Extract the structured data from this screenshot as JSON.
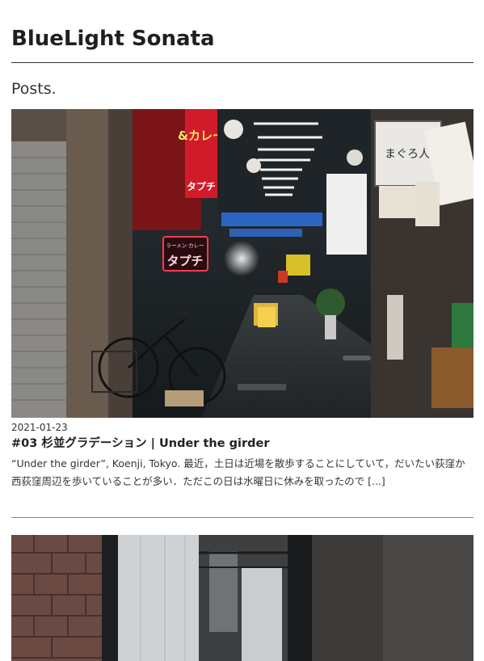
{
  "site": {
    "title": "BlueLight Sonata"
  },
  "section": {
    "title": "Posts."
  },
  "posts": [
    {
      "date": "2021-01-23",
      "title": "#03 杉並グラデーション | Under the girder",
      "excerpt": "“Under the girder”, Koenji, Tokyo. 最近，土日は近場を散歩することにしていて，だいたい荻窪か西荻窪周辺を歩いていることが多い．ただこの日は水曜日に休みを取ったので [...]",
      "image_signs": {
        "curry": "&カレー",
        "curry_sub": "タプチ",
        "ramen_small": "ラーメン·カレー",
        "ramen_big": "タプチ",
        "maguro": "まぐろ人"
      }
    },
    {
      "date": "",
      "title": "",
      "excerpt": ""
    }
  ]
}
